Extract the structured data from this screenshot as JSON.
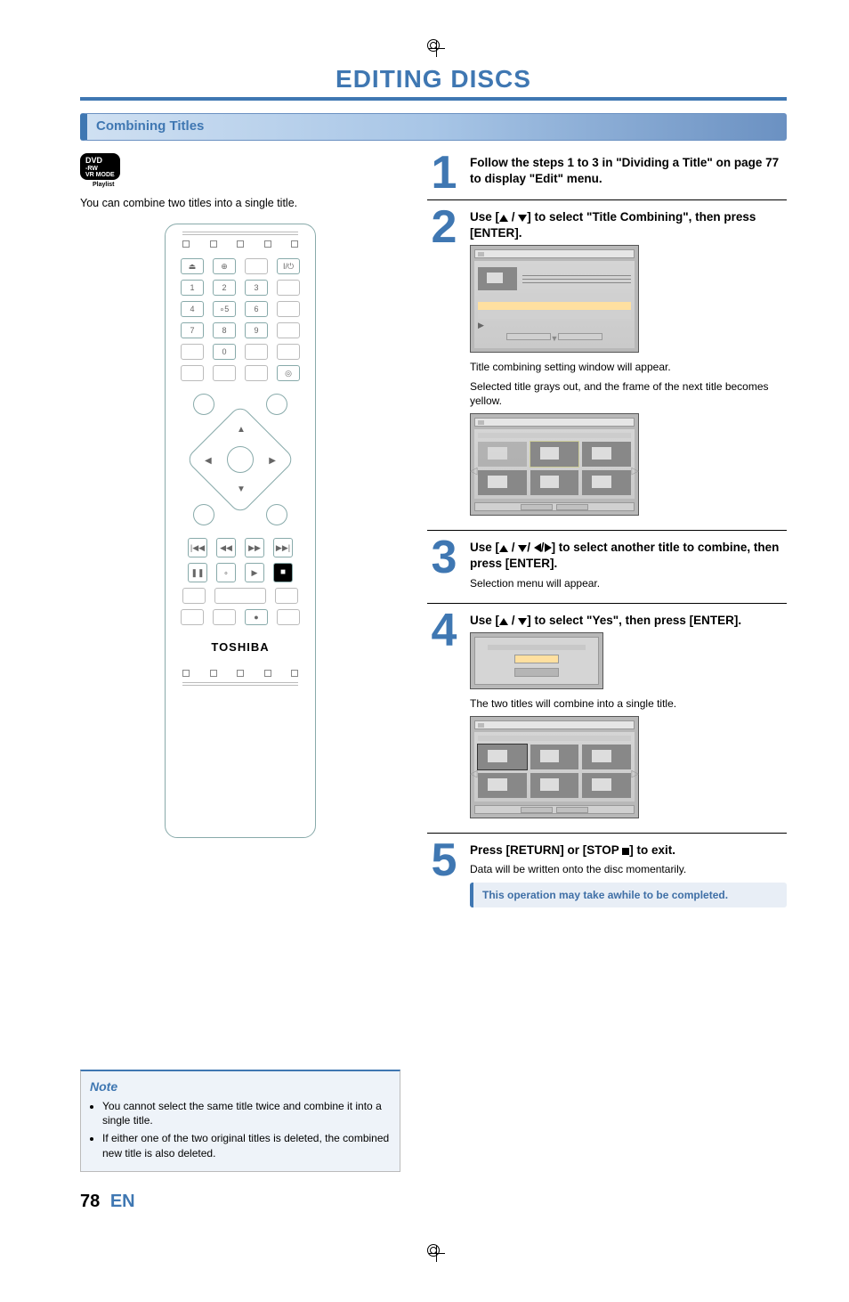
{
  "page_title": "EDITING DISCS",
  "section_heading": "Combining Titles",
  "disc_badge": {
    "main": "DVD",
    "sub1": "-RW",
    "sub2": "VR MODE",
    "caption": "Playlist"
  },
  "intro": "You can combine two titles into a single title.",
  "remote": {
    "eject": "⏏",
    "source": "⊕",
    "power": "I/⏻",
    "num_1": "1",
    "num_2": "2",
    "num_3": "3",
    "num_4": "4",
    "num_5": "∘5",
    "num_6": "6",
    "num_7": "7",
    "num_8": "8",
    "num_9": "9",
    "num_0": "0",
    "disc": "◎",
    "prev": "|◀◀",
    "rew": "◀◀",
    "ffwd": "▶▶",
    "next": "▶▶|",
    "pause": "❚❚",
    "rec_dot": "∘",
    "play": "▶",
    "stop": "■",
    "rec": "●",
    "logo": "TOSHIBA"
  },
  "steps": {
    "s1": {
      "num": "1",
      "title": "Follow the steps 1 to 3 in \"Dividing a Title\" on page 77 to display \"Edit\" menu."
    },
    "s2": {
      "num": "2",
      "title_pre": "Use [",
      "title_mid": " / ",
      "title_post": "] to select \"Title Combining\", then press [ENTER].",
      "desc1": "Title combining setting window will appear.",
      "desc2": "Selected title grays out, and the frame of the next title becomes yellow."
    },
    "s3": {
      "num": "3",
      "title_pre": "Use [",
      "title_mid1": " / ",
      "title_mid2": "/ ",
      "title_mid3": "/",
      "title_post": "] to select another title to combine, then press [ENTER].",
      "desc": "Selection menu will appear."
    },
    "s4": {
      "num": "4",
      "title_pre": "Use [",
      "title_mid": " / ",
      "title_post": "] to select \"Yes\", then press [ENTER].",
      "desc": "The two titles will combine into a single title."
    },
    "s5": {
      "num": "5",
      "title_pre": "Press [RETURN] or [STOP ",
      "title_post": "] to exit.",
      "desc": "Data will be written onto the disc momentarily.",
      "callout": "This operation may take awhile to be completed."
    }
  },
  "note": {
    "heading": "Note",
    "items": [
      "You cannot select the same title twice and combine it into a single title.",
      "If either one of the two original titles is deleted, the combined new title is also deleted."
    ]
  },
  "footer": {
    "page": "78",
    "lang": "EN"
  }
}
